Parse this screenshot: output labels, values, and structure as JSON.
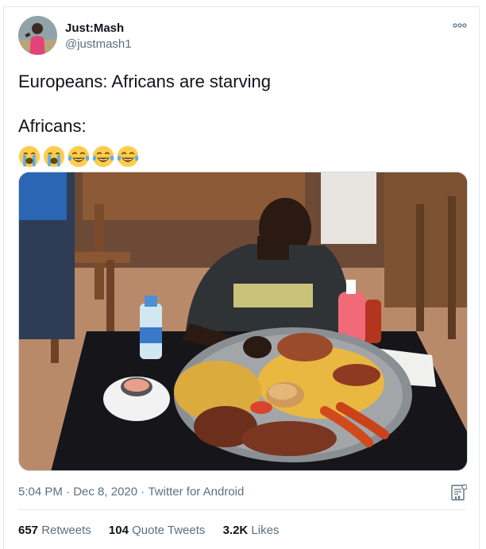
{
  "author": {
    "display_name": "Just:Mash",
    "handle": "@justmash1"
  },
  "tweet": {
    "lines": [
      "Europeans: Africans are starving",
      "",
      "Africans:"
    ],
    "emojis": [
      "loudly-crying-face",
      "loudly-crying-face",
      "face-with-tears-of-joy",
      "face-with-tears-of-joy",
      "face-with-tears-of-joy"
    ],
    "emoji_text": "😭😭😂😂😂"
  },
  "media": {
    "photo_icon": "photo-of-man-eating-large-platter"
  },
  "meta": {
    "time": "5:04 PM",
    "separator": "·",
    "date": "Dec 8, 2020",
    "source": "Twitter for Android"
  },
  "stats": {
    "retweets_count": "657",
    "retweets_label": "Retweets",
    "quote_count": "104",
    "quote_label": "Quote Tweets",
    "likes_count": "3.2K",
    "likes_label": "Likes"
  },
  "colors": {
    "primary_text": "#0f1419",
    "secondary_text": "#5b7083",
    "divider": "#e1e8ed",
    "emoji_yellow": "#ffcc4d",
    "tear_blue": "#5dadec"
  },
  "icons": {
    "more": "more-dots-icon",
    "analytics": "tweet-activity-icon"
  }
}
